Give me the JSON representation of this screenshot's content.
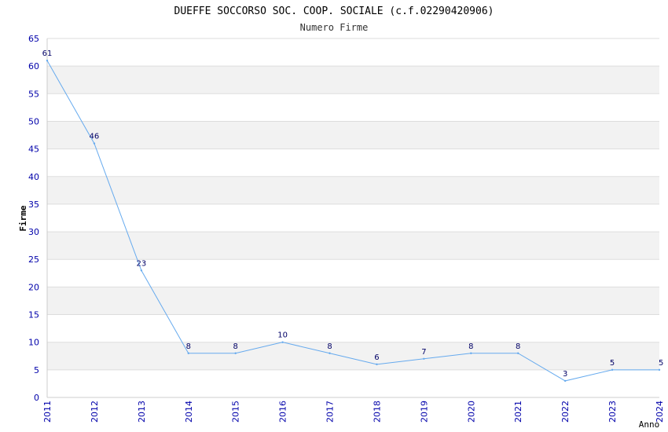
{
  "chart_data": {
    "type": "line",
    "title": "DUEFFE SOCCORSO SOC. COOP. SOCIALE (c.f.02290420906)",
    "subtitle": "Numero Firme",
    "xlabel": "Anno",
    "ylabel": "Firme",
    "categories": [
      "2011",
      "2012",
      "2013",
      "2014",
      "2015",
      "2016",
      "2017",
      "2018",
      "2019",
      "2020",
      "2021",
      "2022",
      "2023",
      "2024"
    ],
    "series": [
      {
        "values": [
          61,
          46,
          23,
          8,
          8,
          10,
          8,
          6,
          7,
          8,
          8,
          3,
          5,
          5
        ]
      }
    ],
    "ylim": [
      0,
      65
    ],
    "yticks": [
      0,
      5,
      10,
      15,
      20,
      25,
      30,
      35,
      40,
      45,
      50,
      55,
      60,
      65
    ],
    "grid": true,
    "colors": {
      "line": "#66aaee",
      "band": "#f2f2f2",
      "tick": "#0000aa",
      "label": "#000066"
    }
  }
}
